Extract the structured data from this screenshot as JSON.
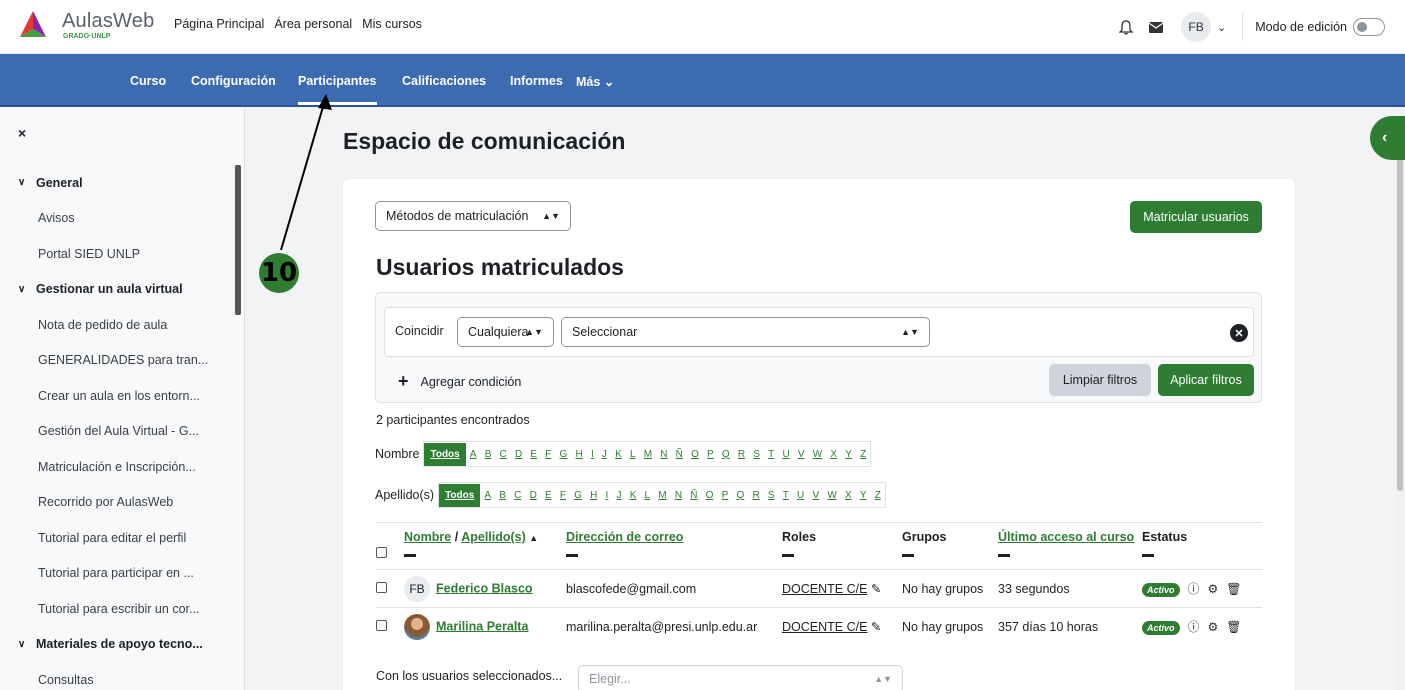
{
  "brand": {
    "name": "AulasWeb",
    "sub": "GRADO·UNLP"
  },
  "topnav": {
    "home": "Página Principal",
    "personal": "Área personal",
    "courses": "Mis cursos"
  },
  "user": {
    "initials": "FB"
  },
  "edit_mode": {
    "label": "Modo de edición"
  },
  "secnav": {
    "curso": "Curso",
    "config": "Configuración",
    "participantes": "Participantes",
    "calificaciones": "Calificaciones",
    "informes": "Informes",
    "mas": "Más"
  },
  "drawer": {
    "close": "×",
    "items": [
      {
        "label": "General",
        "section": true
      },
      {
        "label": "Avisos"
      },
      {
        "label": "Portal SIED UNLP"
      },
      {
        "label": "Gestionar un aula virtual",
        "section": true
      },
      {
        "label": "Nota de pedido de aula"
      },
      {
        "label": "GENERALIDADES para tran..."
      },
      {
        "label": "Crear un aula en los entorn..."
      },
      {
        "label": "Gestión del Aula Virtual - G..."
      },
      {
        "label": "Matriculación e Inscripción..."
      },
      {
        "label": "Recorrido por AulasWeb"
      },
      {
        "label": "Tutorial para editar el perfil"
      },
      {
        "label": "Tutorial para participar en ..."
      },
      {
        "label": "Tutorial para escribir un cor..."
      },
      {
        "label": "Materiales de apoyo tecno...",
        "section": true
      },
      {
        "label": "Consultas"
      }
    ]
  },
  "page": {
    "title": "Espacio de comunicación"
  },
  "enrol": {
    "methods": "Métodos de matriculación",
    "enrol_button": "Matricular usuarios"
  },
  "users": {
    "heading": "Usuarios matriculados"
  },
  "filter": {
    "match_label": "Coincidir",
    "match_value": "Cualquiera",
    "select_value": "Seleccionar",
    "add_condition": "Agregar condición",
    "clear": "Limpiar filtros",
    "apply": "Aplicar filtros"
  },
  "found": "2 participantes encontrados",
  "firstname": {
    "label": "Nombre"
  },
  "lastname": {
    "label": "Apellido(s)"
  },
  "letters": [
    "Todos",
    "A",
    "B",
    "C",
    "D",
    "E",
    "F",
    "G",
    "H",
    "I",
    "J",
    "K",
    "L",
    "M",
    "N",
    "Ñ",
    "O",
    "P",
    "Q",
    "R",
    "S",
    "T",
    "U",
    "V",
    "W",
    "X",
    "Y",
    "Z"
  ],
  "table": {
    "col_name": "Nombre",
    "col_sep": " / ",
    "col_lastname": "Apellido(s)",
    "col_email": "Dirección de correo",
    "col_roles": "Roles",
    "col_groups": "Grupos",
    "col_last": "Último acceso al curso",
    "col_status": "Estatus",
    "rows": [
      {
        "initials": "FB",
        "name": "Federico Blasco",
        "email": "blascofede@gmail.com",
        "role": "DOCENTE C/E",
        "groups": "No hay grupos",
        "last": "33 segundos",
        "status": "Activo"
      },
      {
        "initials": "",
        "name": "Marilina Peralta",
        "email": "marilina.peralta@presi.unlp.edu.ar",
        "role": "DOCENTE C/E",
        "groups": "No hay grupos",
        "last": "357 días 10 horas",
        "status": "Activo"
      }
    ]
  },
  "bulk": {
    "label": "Con los usuarios seleccionados...",
    "placeholder": "Elegir..."
  },
  "annotation": {
    "number": "10"
  }
}
